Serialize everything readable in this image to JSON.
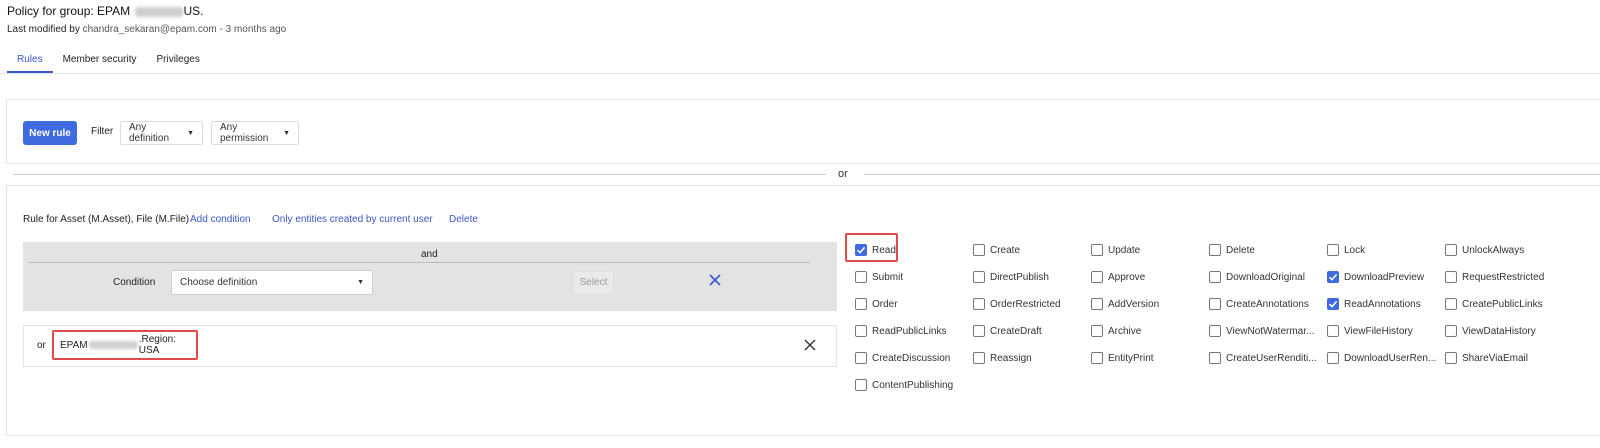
{
  "header": {
    "title_prefix": "Policy for group: EPAM",
    "title_suffix": "US.",
    "modified_prefix": "Last modified by",
    "modified_user": "chandra_sekaran@epam.com",
    "modified_time": "- 3 months ago"
  },
  "tabs": [
    {
      "label": "Rules",
      "active": true
    },
    {
      "label": "Member security",
      "active": false
    },
    {
      "label": "Privileges",
      "active": false
    }
  ],
  "toolbar": {
    "new_rule": "New rule",
    "filter": "Filter",
    "definition": "Any definition",
    "permission": "Any permission"
  },
  "separator": "or",
  "rule": {
    "title": "Rule for Asset (M.Asset), File (M.File)",
    "add_condition": "Add condition",
    "only_entities": "Only entities created by current user",
    "delete": "Delete",
    "and": "and",
    "condition_label": "Condition",
    "condition_placeholder": "Choose definition",
    "select_button": "Select",
    "or_label": "or",
    "region_prefix": "EPAM",
    "region_suffix": ".Region: USA"
  },
  "permissions": [
    {
      "label": "Read",
      "checked": true
    },
    {
      "label": "Create",
      "checked": false
    },
    {
      "label": "Update",
      "checked": false
    },
    {
      "label": "Delete",
      "checked": false
    },
    {
      "label": "Lock",
      "checked": false
    },
    {
      "label": "UnlockAlways",
      "checked": false
    },
    {
      "label": "Submit",
      "checked": false
    },
    {
      "label": "DirectPublish",
      "checked": false
    },
    {
      "label": "Approve",
      "checked": false
    },
    {
      "label": "DownloadOriginal",
      "checked": false
    },
    {
      "label": "DownloadPreview",
      "checked": true
    },
    {
      "label": "RequestRestricted",
      "checked": false
    },
    {
      "label": "Order",
      "checked": false
    },
    {
      "label": "OrderRestricted",
      "checked": false
    },
    {
      "label": "AddVersion",
      "checked": false
    },
    {
      "label": "CreateAnnotations",
      "checked": false
    },
    {
      "label": "ReadAnnotations",
      "checked": true
    },
    {
      "label": "CreatePublicLinks",
      "checked": false
    },
    {
      "label": "ReadPublicLinks",
      "checked": false
    },
    {
      "label": "CreateDraft",
      "checked": false
    },
    {
      "label": "Archive",
      "checked": false
    },
    {
      "label": "ViewNotWatermar...",
      "checked": false
    },
    {
      "label": "ViewFileHistory",
      "checked": false
    },
    {
      "label": "ViewDataHistory",
      "checked": false
    },
    {
      "label": "CreateDiscussion",
      "checked": false
    },
    {
      "label": "Reassign",
      "checked": false
    },
    {
      "label": "EntityPrint",
      "checked": false
    },
    {
      "label": "CreateUserRenditi...",
      "checked": false
    },
    {
      "label": "DownloadUserRen...",
      "checked": false
    },
    {
      "label": "ShareViaEmail",
      "checked": false
    },
    {
      "label": "ContentPublishing",
      "checked": false
    }
  ],
  "colors": {
    "accent": "#3f6ae0",
    "highlight": "#e14b4b"
  }
}
